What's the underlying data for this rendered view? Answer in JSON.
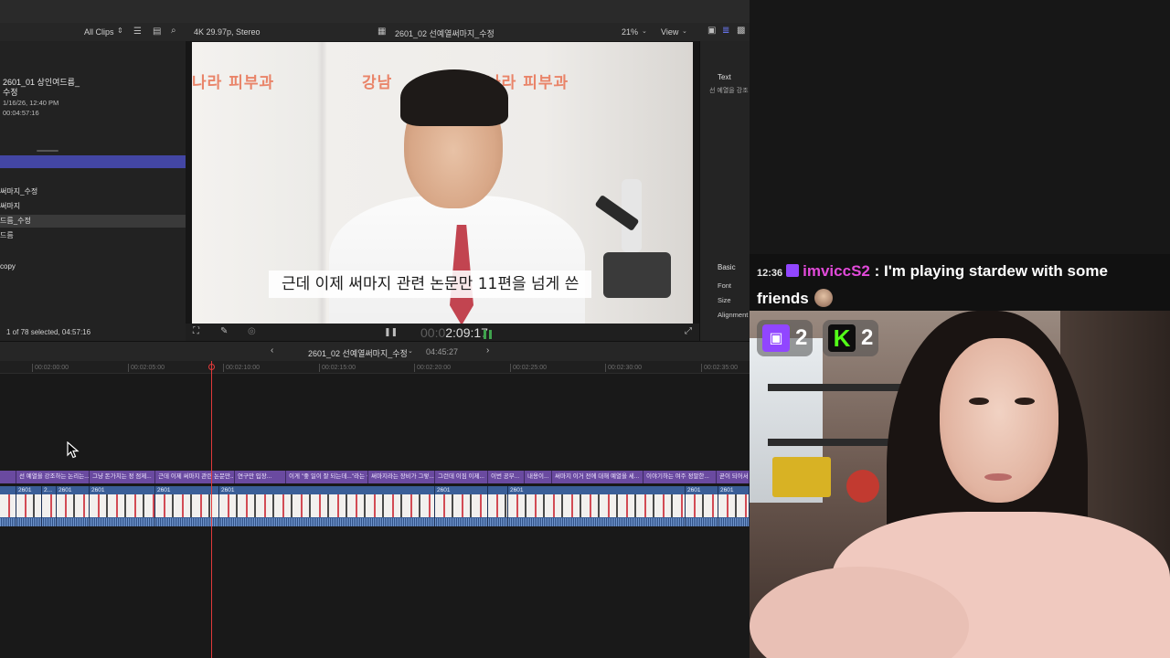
{
  "toolbar": {
    "filter_label": "All Clips",
    "format_info": "4K 29.97p, Stereo",
    "project_title": "2601_02 선예열써마지_수정",
    "zoom_level": "21%",
    "view_label": "View"
  },
  "browser": {
    "clip_title_line1": "2601_01 상인여드름_",
    "clip_title_line2": "수정",
    "clip_date": "1/16/26, 12:40 PM",
    "clip_duration": "00:04:57:16",
    "rows": [
      {
        "label": "써마지_수정"
      },
      {
        "label": "써마지"
      },
      {
        "label": "드름_수정"
      },
      {
        "label": "드름"
      },
      {
        "label": "copy"
      }
    ],
    "selection_status": "1 of 78 selected, 04:57:16"
  },
  "viewer": {
    "sign_left": "나라 피부과",
    "sign_center": "강남",
    "sign_right": "나라 피부과",
    "subtitle": "근데 이제 써마지 관련 논문만 11편을 넘게 쓴",
    "timecode_dim": "00:0",
    "timecode": "2:09:17"
  },
  "inspector": {
    "tab_text": "Text",
    "preview_text": "선 예열을 강조",
    "basic_label": "Basic",
    "font_label": "Font",
    "size_label": "Size",
    "alignment_label": "Alignment"
  },
  "timeline": {
    "project_name": "2601_02 선예열써마지_수정",
    "duration": "04:45:27",
    "ruler_ticks": [
      "00:02:00:00",
      "00:02:05:00",
      "00:02:10:00",
      "00:02:15:00",
      "00:02:20:00",
      "00:02:25:00",
      "00:02:30:00",
      "00:02:35:00"
    ],
    "title_clips": [
      "선 예열을 강조하는 논리는...",
      "그냥 돈가치는 정 점제...",
      "근데 이제 써마지 관련 논문만...",
      "연구만 입장...",
      "이게 \"좋 일이 잘 되는데...\"라는 생각...",
      "써마지라는 장비가 그렇...",
      "그런데 이짐 이제...",
      "이번 공부...",
      "내용이...",
      "써마지 이거 전에 대해 예열을 세...",
      "이야기하는 여주 정말한...",
      "곧이 되어서"
    ],
    "video_clip_labels": [
      "2601",
      "2...",
      "2601",
      "2601",
      "2601",
      "2601",
      "2601",
      "2601",
      "2601",
      "2601",
      "2601"
    ]
  },
  "chat": {
    "time": "12:36",
    "username": "imviccS2",
    "message": " : I'm playing stardew with some friends"
  },
  "overlay": {
    "twitch_count": "2",
    "kick_count": "2",
    "twitch_color": "#9146ff",
    "kick_color": "#53fc18"
  }
}
